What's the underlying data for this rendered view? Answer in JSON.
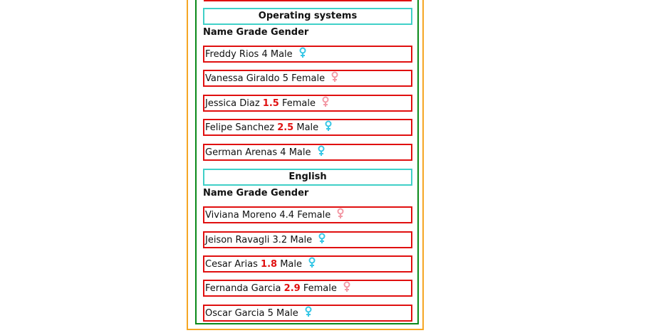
{
  "sections": [
    {
      "title": "Operating systems",
      "columns": "Name Grade Gender",
      "students": [
        {
          "name": "Freddy Rios",
          "grade": "4",
          "gender": "Male",
          "low": false,
          "icon_color": "#38c7e6"
        },
        {
          "name": "Vanessa Giraldo",
          "grade": "5",
          "gender": "Female",
          "low": false,
          "icon_color": "#f39aa6"
        },
        {
          "name": "Jessica Diaz",
          "grade": "1.5",
          "gender": "Female",
          "low": true,
          "icon_color": "#f39aa6"
        },
        {
          "name": "Felipe Sanchez",
          "grade": "2.5",
          "gender": "Male",
          "low": true,
          "icon_color": "#38c7e6"
        },
        {
          "name": "German Arenas",
          "grade": "4",
          "gender": "Male",
          "low": false,
          "icon_color": "#38c7e6"
        }
      ]
    },
    {
      "title": "English",
      "columns": "Name Grade Gender",
      "students": [
        {
          "name": "Viviana Moreno",
          "grade": "4.4",
          "gender": "Female",
          "low": false,
          "icon_color": "#f39aa6"
        },
        {
          "name": "Jeison Ravagli",
          "grade": "3.2",
          "gender": "Male",
          "low": false,
          "icon_color": "#38c7e6"
        },
        {
          "name": "Cesar Arias",
          "grade": "1.8",
          "gender": "Male",
          "low": true,
          "icon_color": "#38c7e6"
        },
        {
          "name": "Fernanda Garcia",
          "grade": "2.9",
          "gender": "Female",
          "low": true,
          "icon_color": "#f39aa6"
        },
        {
          "name": "Oscar Garcia",
          "grade": "5",
          "gender": "Male",
          "low": false,
          "icon_color": "#38c7e6"
        }
      ]
    }
  ]
}
